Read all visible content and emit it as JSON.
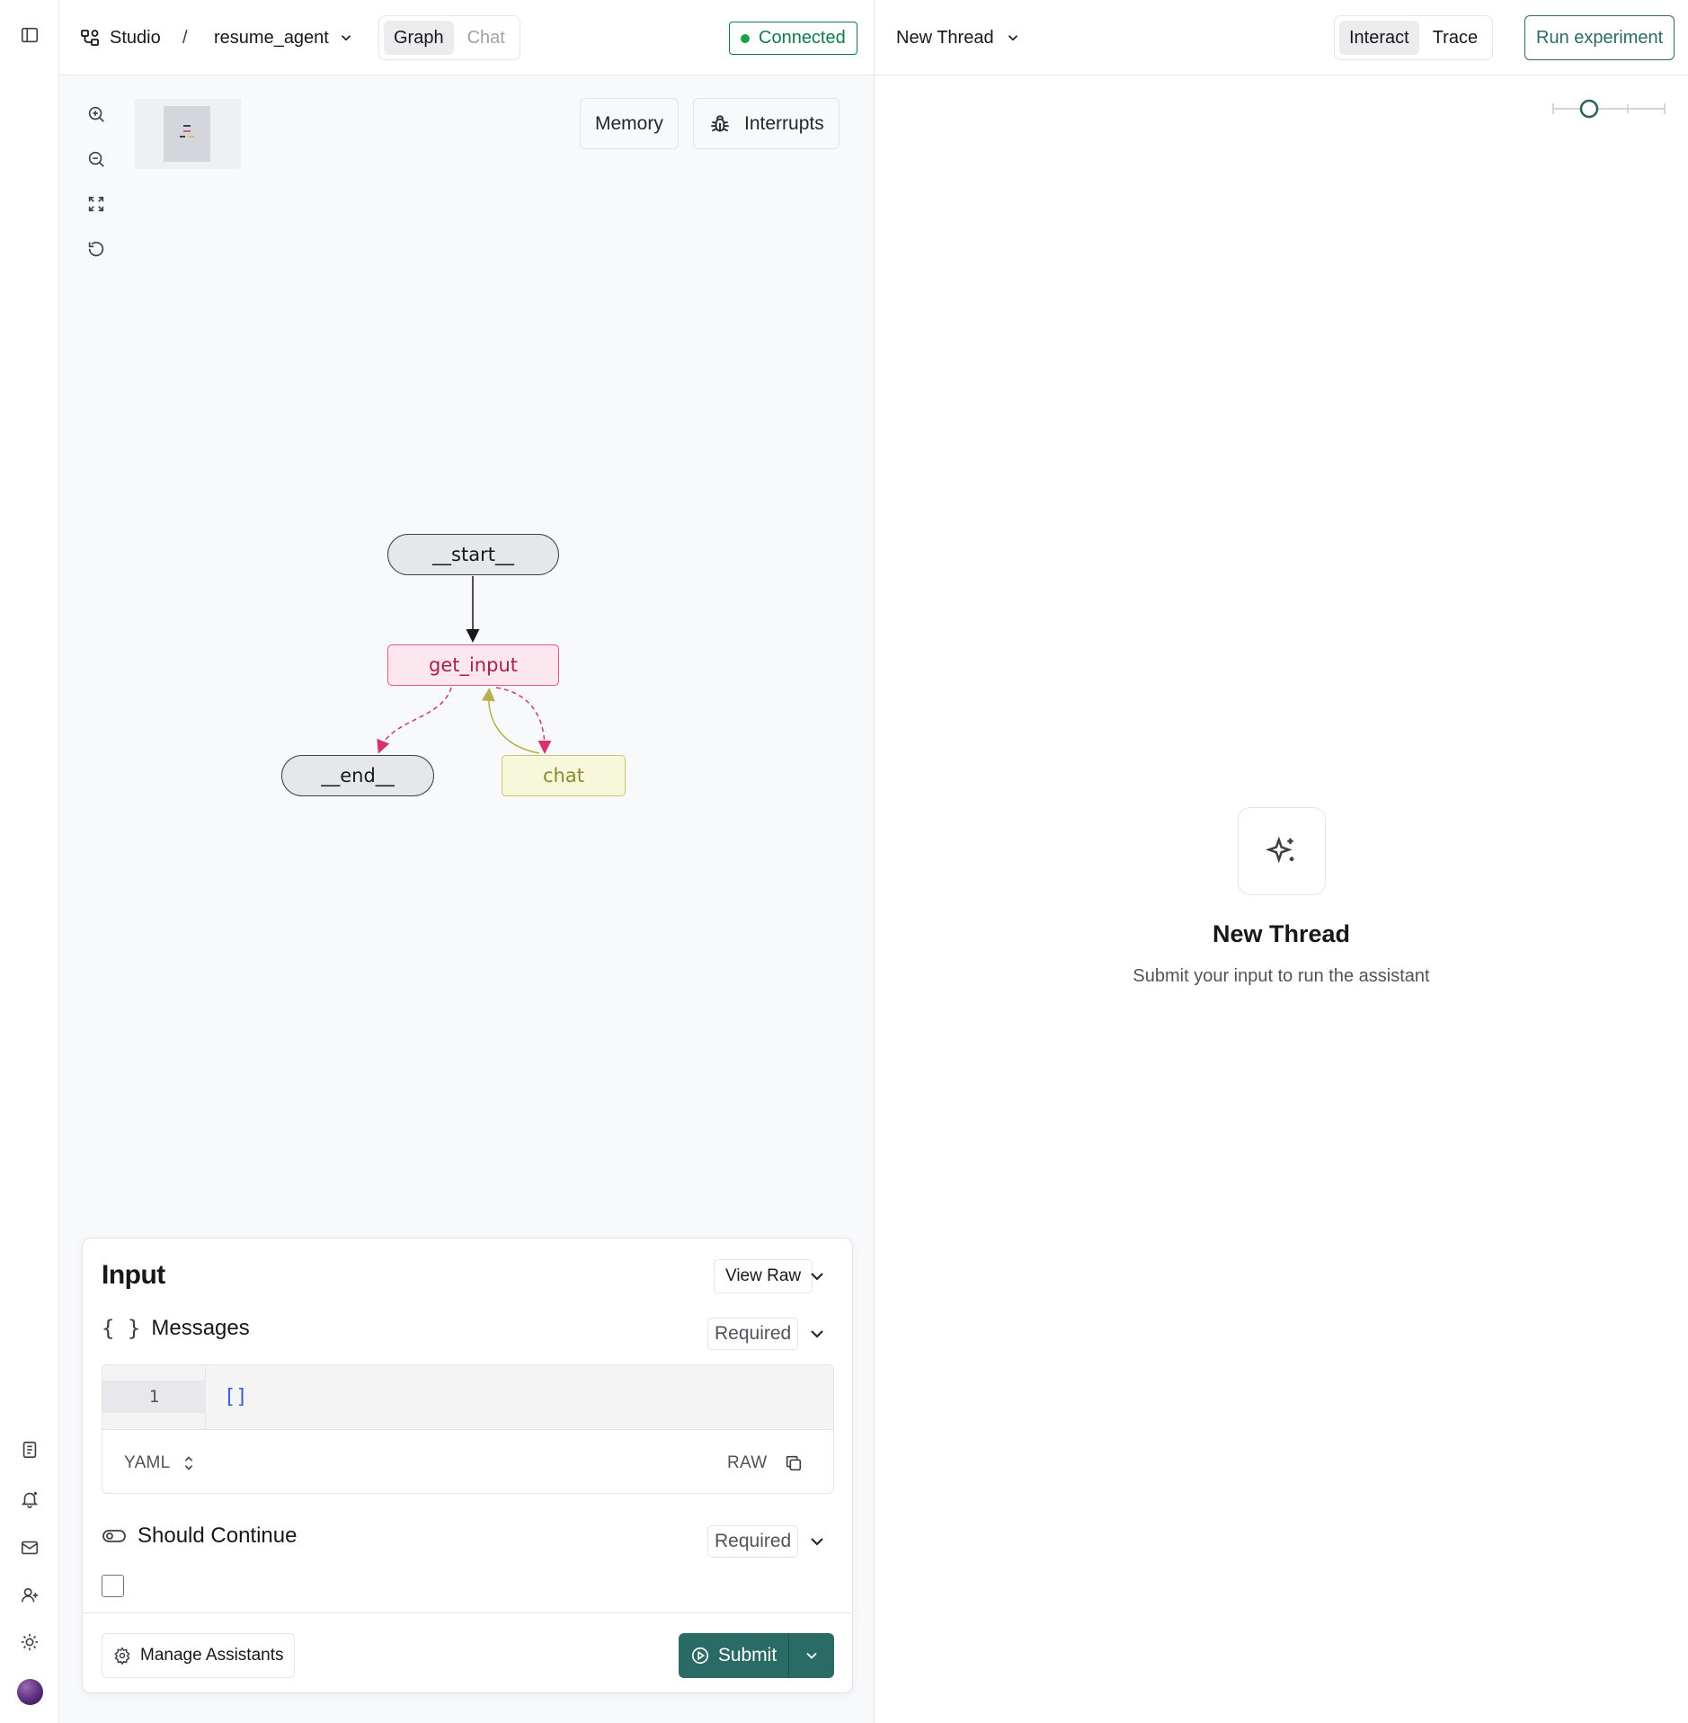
{
  "breadcrumb": {
    "root": "Studio",
    "separator": "/",
    "project": "resume_agent"
  },
  "view_tabs": [
    {
      "label": "Graph",
      "active": true
    },
    {
      "label": "Chat",
      "active": false
    }
  ],
  "connection": {
    "status": "Connected",
    "color": "#16a34a"
  },
  "graph_toolbar": {
    "memory_label": "Memory",
    "interrupts_label": "Interrupts"
  },
  "graph": {
    "nodes": {
      "start": "__start__",
      "get_input": "get_input",
      "end": "__end__",
      "chat": "chat"
    }
  },
  "input_panel": {
    "title": "Input",
    "view_raw_label": "View Raw",
    "messages": {
      "label": "Messages",
      "badge": "Required",
      "line_number": "1",
      "code": "[]",
      "format": "YAML",
      "raw_label": "RAW"
    },
    "should_continue": {
      "label": "Should Continue",
      "badge": "Required",
      "checked": false
    },
    "manage_assistants_label": "Manage Assistants",
    "submit_label": "Submit"
  },
  "thread_panel": {
    "thread_selector": "New Thread",
    "mode_tabs": [
      {
        "label": "Interact",
        "active": true
      },
      {
        "label": "Trace",
        "active": false
      }
    ],
    "run_experiment_label": "Run experiment",
    "empty_state": {
      "title": "New Thread",
      "subtitle": "Submit your input to run the assistant"
    }
  },
  "colors": {
    "accent": "#2b6b65",
    "connected": "#0e7a4a",
    "get_input_edge": "#d6336c",
    "chat_edge": "#b8b04a"
  }
}
